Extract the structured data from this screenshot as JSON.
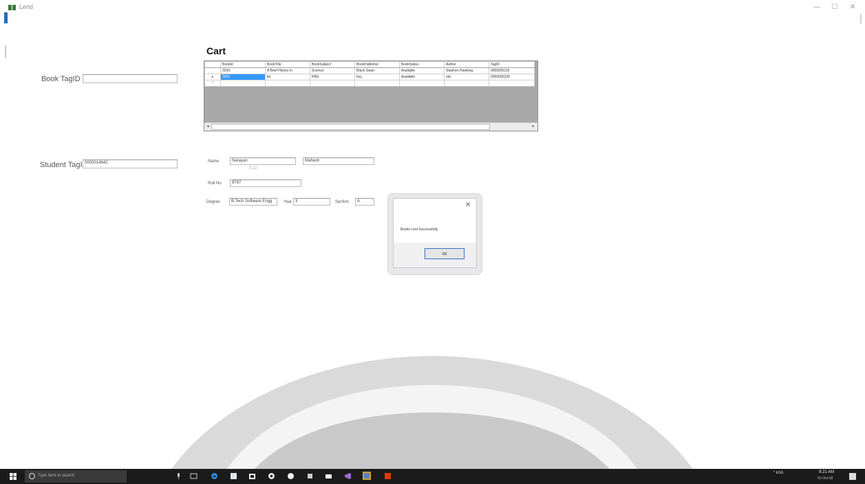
{
  "window": {
    "title": "Lend",
    "min_glyph": "—",
    "max_glyph": "☐",
    "close_glyph": "✕"
  },
  "left_panel": {
    "book_tag_label": "Book TagID",
    "book_tag_value": "",
    "student_tag_label": "Student TagID",
    "student_tag_value": "0000014642"
  },
  "cart": {
    "title": "Cart",
    "columns": [
      "BookId",
      "BookTitle",
      "BookSubject",
      "BookPublisher",
      "BookStatus",
      "Author",
      "TagID"
    ],
    "rows": [
      {
        "marker": "",
        "cells": [
          "3243",
          "A Brief History in",
          "Science",
          "Black Swan",
          "Available",
          "Stephen Hawking",
          "0000000115"
        ]
      },
      {
        "marker": "▸",
        "cells": [
          "3201",
          "jbi",
          "KBG",
          "bsy",
          "Available",
          "sfyi",
          "0000000239"
        ]
      },
      {
        "marker": "*",
        "cells": [
          "",
          "",
          "",
          "",
          "",
          "",
          ""
        ]
      }
    ],
    "scroll_left": "◂",
    "scroll_right": "▸"
  },
  "student": {
    "name_label": "Name",
    "first_name": "Narayan",
    "last_name": "Mahesh",
    "first_name_caption": "0.22",
    "roll_label": "Roll No",
    "roll_value": "8767",
    "degree_label": "Degree",
    "degree_value": "B.Tech Software Engg",
    "year_label": "Year",
    "year_value": "3",
    "section_label": "Section",
    "section_value": "A"
  },
  "dialog": {
    "message": "Books Lent Successfully",
    "ok_label": "OK",
    "close_glyph": "✕"
  },
  "taskbar": {
    "search_placeholder": "Type here to search",
    "tray_text": "^ ENG",
    "time": "9:21 AM",
    "date": "01-Oct-18"
  },
  "colors": {
    "selection": "#3399ff",
    "ok_border": "#2e72c8",
    "taskbar": "#1b1b1b",
    "grid_empty": "#a9a9a9"
  },
  "icons": [
    "app-icon",
    "windows-start-icon",
    "search-icon",
    "mic-icon",
    "task-view-icon",
    "edge-icon",
    "store-icon",
    "explorer-icon",
    "chrome-icon",
    "whatsapp-icon",
    "app-icon-generic",
    "mail-icon",
    "visual-studio-icon",
    "sticky-app-icon",
    "office-icon",
    "notification-icon"
  ]
}
